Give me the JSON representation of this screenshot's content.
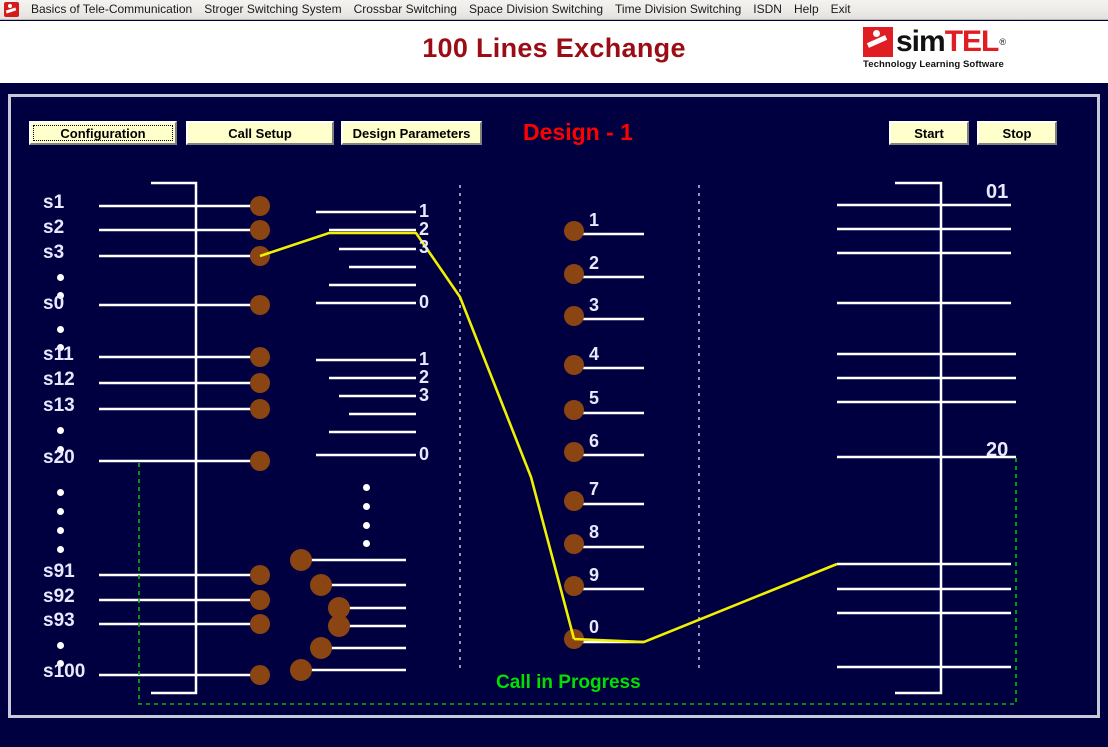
{
  "window": {
    "app_icon": "simtel-app-icon"
  },
  "menubar": {
    "items": [
      {
        "label": "Basics of Tele-Communication"
      },
      {
        "label": "Stroger Switching System"
      },
      {
        "label": "Crossbar Switching"
      },
      {
        "label": "Space Division Switching"
      },
      {
        "label": "Time Division Switching"
      },
      {
        "label": "ISDN"
      },
      {
        "label": "Help"
      },
      {
        "label": "Exit"
      }
    ]
  },
  "header": {
    "title": "100 Lines Exchange",
    "logo": {
      "sim": "sim",
      "tel": "TEL",
      "registered": "®",
      "tagline": "Technology Learning  Software"
    }
  },
  "toolbar": {
    "configuration_label": "Configuration",
    "call_setup_label": "Call Setup",
    "design_parameters_label": "Design Parameters",
    "start_label": "Start",
    "stop_label": "Stop"
  },
  "diagram": {
    "design_label": "Design - 1",
    "status_label": "Call in Progress",
    "subscriber_labels": [
      "s1",
      "s2",
      "s3",
      "s0",
      "s11",
      "s12",
      "s13",
      "s20",
      "s91",
      "s92",
      "s93",
      "s100"
    ],
    "selector_group_top": [
      "1",
      "2",
      "3",
      "0"
    ],
    "selector_group_bottom": [
      "1",
      "2",
      "3",
      "0"
    ],
    "connector_digits": [
      "1",
      "2",
      "3",
      "4",
      "5",
      "6",
      "7",
      "8",
      "9",
      "0"
    ],
    "outgoing_labels": [
      "01",
      "20"
    ]
  },
  "colors": {
    "panel_background": "#000040",
    "line": "#ffffff",
    "call_path": "#f0f000",
    "contact_dot": "#8B4513",
    "status_text": "#00e000",
    "design_text": "#ff0000",
    "title_text": "#9b0d14",
    "button_face": "#ffffcc",
    "boundary_dash": "#00c000"
  }
}
